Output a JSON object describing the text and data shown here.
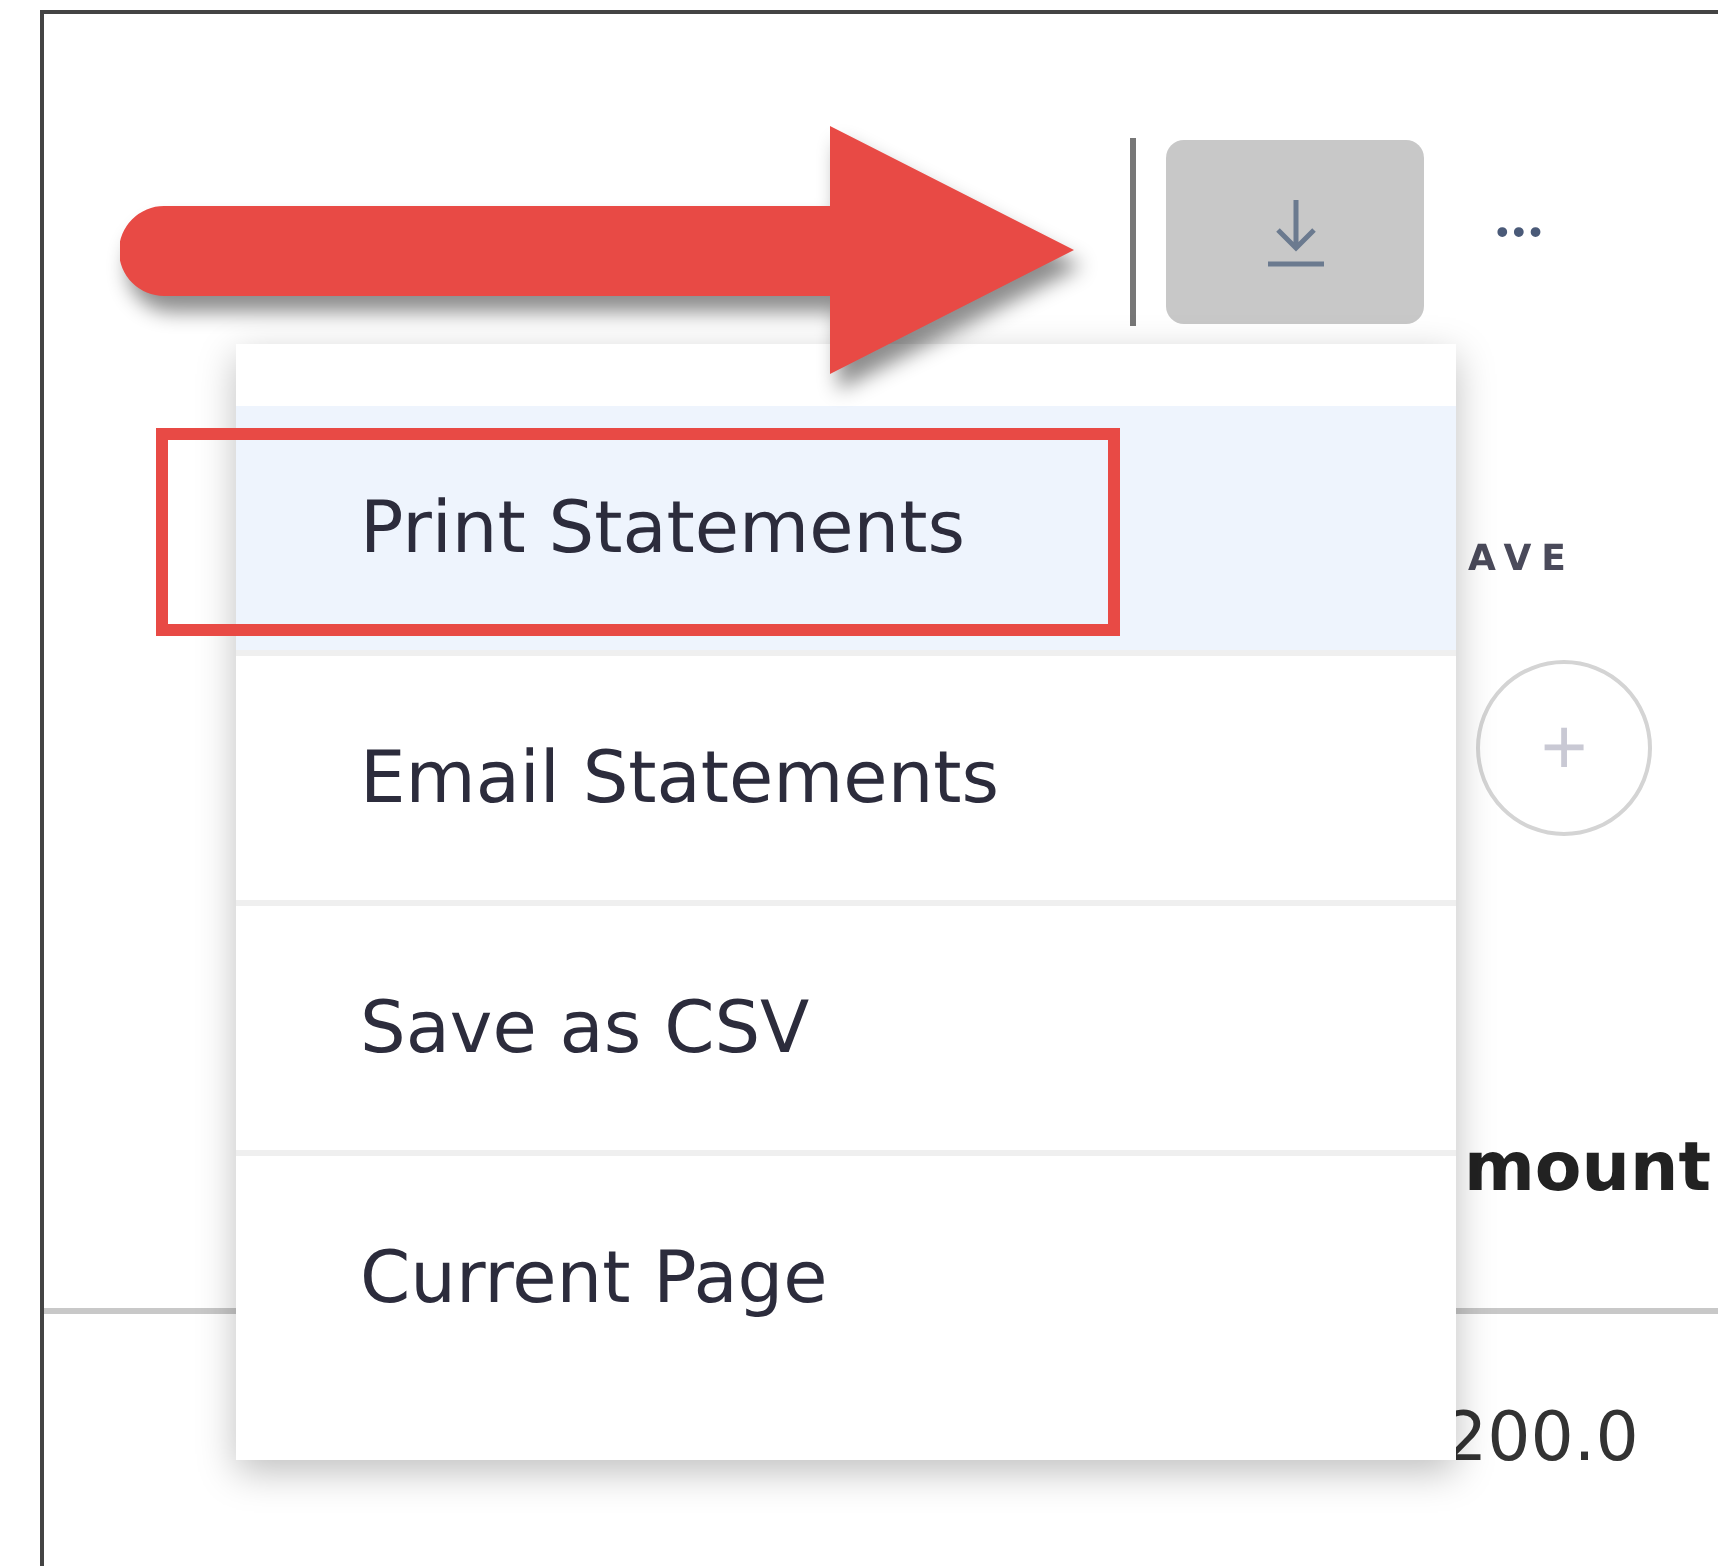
{
  "toolbar": {
    "download_button": {
      "pressed": true
    },
    "more_button": {
      "label": "•••"
    }
  },
  "background": {
    "column_header": "AVE",
    "add_button": {
      "label": "+"
    },
    "amount_header": "mount",
    "amount_value": "200.0"
  },
  "menu": {
    "items": [
      {
        "label": "Print Statements",
        "selected": true,
        "annotated": true
      },
      {
        "label": "Email Statements",
        "selected": false,
        "annotated": false
      },
      {
        "label": "Save as CSV",
        "selected": false,
        "annotated": false
      },
      {
        "label": "Current Page",
        "selected": false,
        "annotated": false
      }
    ]
  },
  "annotation": {
    "arrow": true
  }
}
